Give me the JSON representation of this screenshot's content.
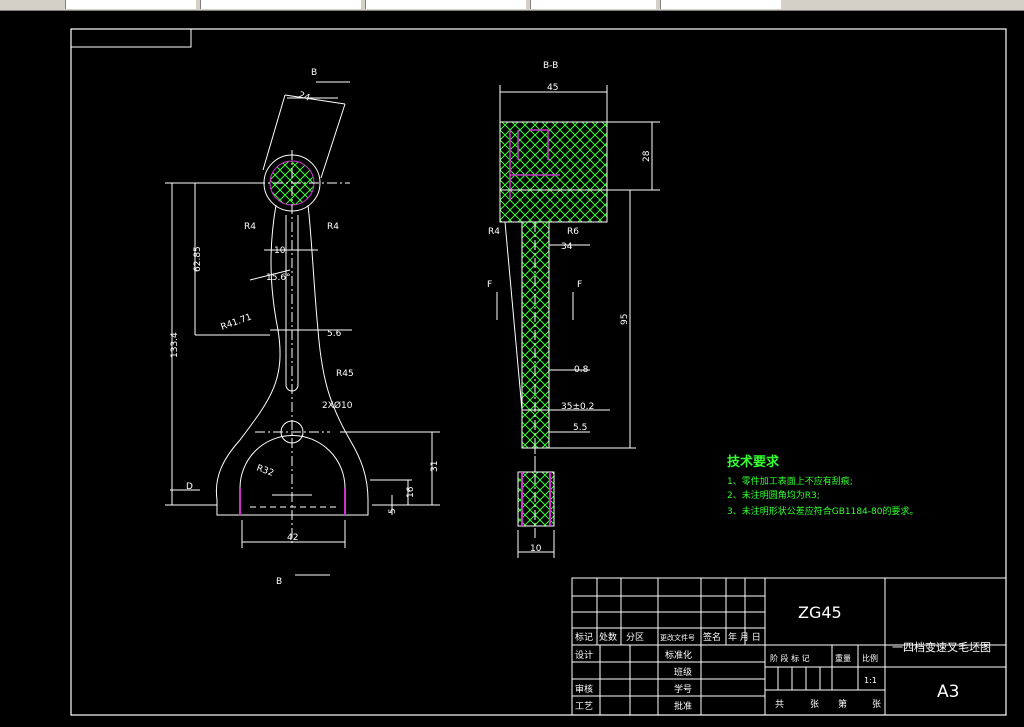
{
  "section_label": "B-B",
  "section_marks": {
    "top": "B",
    "bottom": "B",
    "f_left": "F",
    "f_right": "F",
    "d": "D"
  },
  "dims_left": {
    "d24": "24",
    "r4_left": "R4",
    "r4_right": "R4",
    "d10": "10",
    "d6285": "62.85",
    "angle": "15.6°",
    "r4171": "R41.71",
    "d56": "5.6",
    "d1334": "133.4",
    "r45": "R45",
    "holes": "2XØ10",
    "r32": "R32",
    "d31": "31",
    "d16": "16",
    "d5": "5",
    "d42": "42"
  },
  "dims_right": {
    "d45": "45",
    "d28": "28",
    "r4": "R4",
    "r6": "R6",
    "d34": "34",
    "d95": "95",
    "d08": "0.8",
    "d35": "35±0.2",
    "d55": "5.5",
    "d10": "10"
  },
  "tech_req": {
    "title": "技术要求",
    "items": [
      "1、零件加工表面上不应有刮痕;",
      "2、未注明圆角均为R3;",
      "3、未注明形状公差应符合GB1184-80的要求。"
    ]
  },
  "title_block": {
    "material": "ZG45",
    "part_name": "一四档变速叉毛坯图",
    "sheet_size": "A3",
    "scale": "1:1",
    "hdr_biaoji": "标记",
    "hdr_chushu": "处数",
    "hdr_fenqu": "分区",
    "hdr_gengai": "更改文件号",
    "hdr_qianming": "签名",
    "hdr_nianyueri": "年 月 日",
    "sheji": "设计",
    "biaozhunhua": "标准化",
    "shenhe": "审核",
    "gongyi": "工艺",
    "banji": "班级",
    "xuehao": "学号",
    "pizhun": "批准",
    "jieduan": "阶 段 标 记",
    "zhongliang": "重量",
    "bili": "比例",
    "gong": "共",
    "zhang1": "张",
    "di": "第",
    "zhang2": "张"
  },
  "colors": {
    "line": "#ffffff",
    "hatch": "#33ff33",
    "thread": "#cc33cc",
    "text_green": "#33ff33"
  }
}
